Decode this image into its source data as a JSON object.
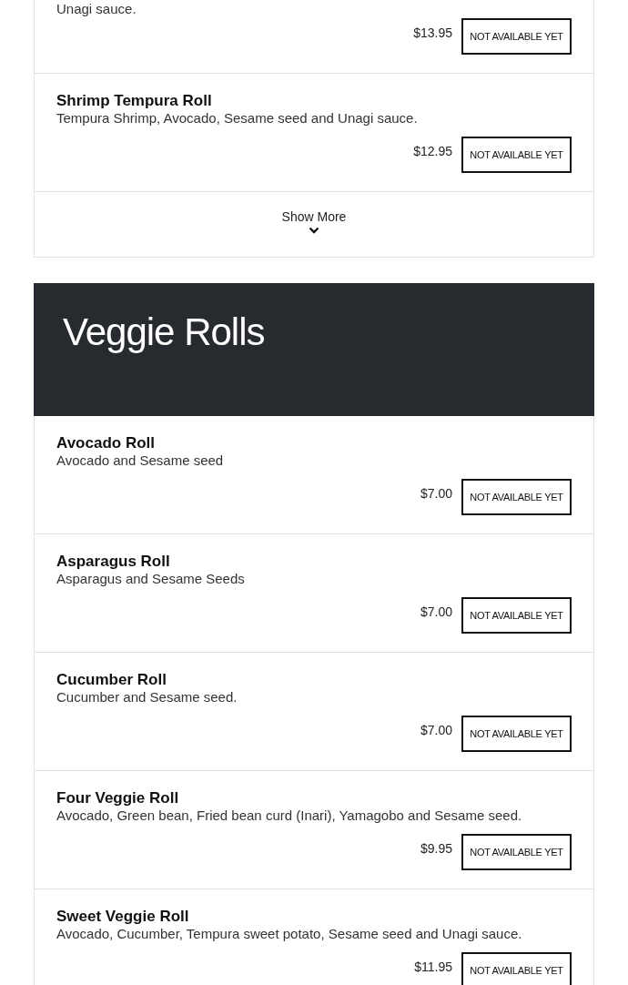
{
  "previous_section": {
    "items": [
      {
        "description": "Unagi sauce.",
        "price": "$13.95",
        "button": "NOT AVAILABLE YET"
      },
      {
        "name": "Shrimp Tempura Roll",
        "description": "Tempura Shrimp, Avocado, Sesame seed and Unagi sauce.",
        "price": "$12.95",
        "button": "NOT AVAILABLE YET"
      }
    ],
    "show_more": "Show More"
  },
  "veggie_section": {
    "title": "Veggie Rolls",
    "items": [
      {
        "name": "Avocado Roll",
        "description": "Avocado and Sesame seed",
        "price": "$7.00",
        "button": "NOT AVAILABLE YET"
      },
      {
        "name": "Asparagus Roll",
        "description": "Asparagus and Sesame Seeds",
        "price": "$7.00",
        "button": "NOT AVAILABLE YET"
      },
      {
        "name": "Cucumber Roll",
        "description": "Cucumber and Sesame seed.",
        "price": "$7.00",
        "button": "NOT AVAILABLE YET"
      },
      {
        "name": "Four Veggie Roll",
        "description": "Avocado, Green bean, Fried bean curd (Inari), Yamagobo and Sesame seed.",
        "price": "$9.95",
        "button": "NOT AVAILABLE YET"
      },
      {
        "name": "Sweet Veggie Roll",
        "description": "Avocado, Cucumber, Tempura sweet potato, Sesame seed and Unagi sauce.",
        "price": "$11.95",
        "button": "NOT AVAILABLE YET"
      }
    ]
  }
}
